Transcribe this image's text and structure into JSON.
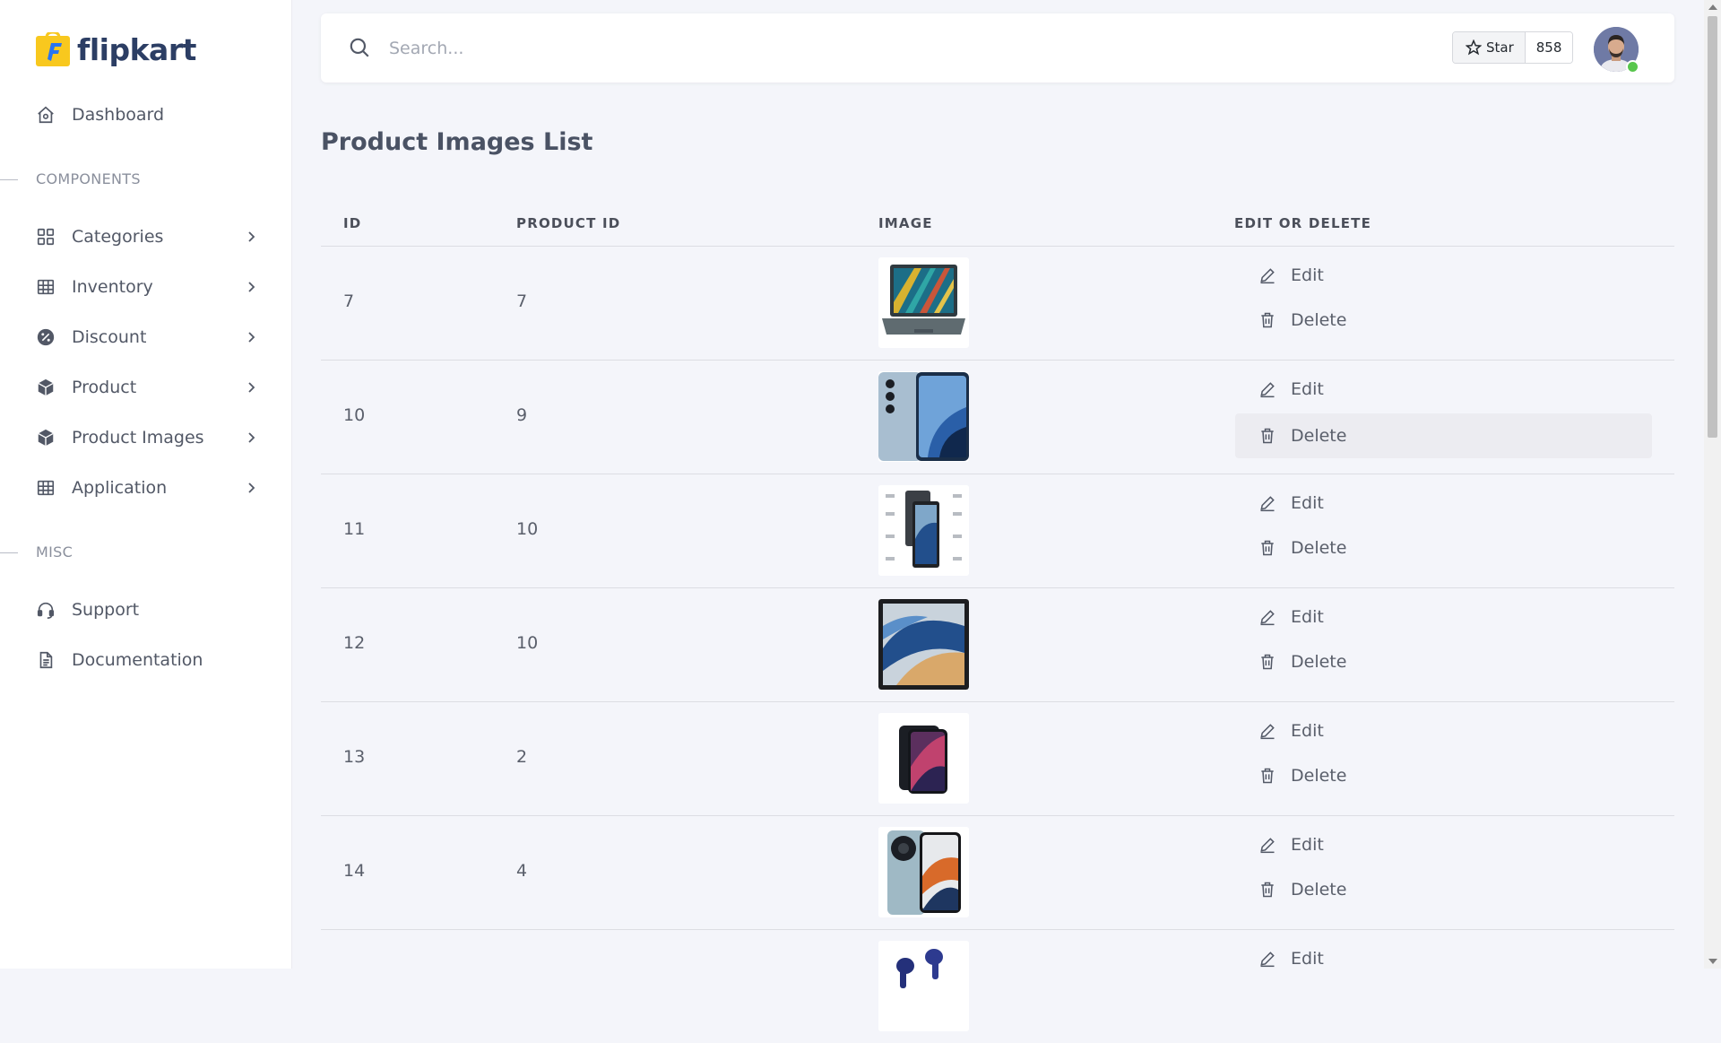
{
  "brand": {
    "name": "flipkart"
  },
  "sidebar": {
    "dashboard": "Dashboard",
    "components_label": "COMPONENTS",
    "items": [
      {
        "label": "Categories",
        "icon": "grid-icon"
      },
      {
        "label": "Inventory",
        "icon": "table-icon"
      },
      {
        "label": "Discount",
        "icon": "discount-badge-icon"
      },
      {
        "label": "Product",
        "icon": "package-icon"
      },
      {
        "label": "Product Images",
        "icon": "package-icon"
      },
      {
        "label": "Application",
        "icon": "table-icon"
      }
    ],
    "misc_label": "MISC",
    "misc_items": [
      {
        "label": "Support",
        "icon": "headset-icon"
      },
      {
        "label": "Documentation",
        "icon": "document-icon"
      }
    ]
  },
  "header": {
    "search_placeholder": "Search...",
    "star_label": "Star",
    "star_count": "858"
  },
  "main": {
    "title": "Product Images List",
    "columns": [
      "ID",
      "PRODUCT ID",
      "IMAGE",
      "EDIT OR DELETE"
    ],
    "edit_label": "Edit",
    "delete_label": "Delete",
    "rows": [
      {
        "id": "7",
        "product_id": "7",
        "image": "laptop"
      },
      {
        "id": "10",
        "product_id": "9",
        "image": "smartphone-blue"
      },
      {
        "id": "11",
        "product_id": "10",
        "image": "tablet-set"
      },
      {
        "id": "12",
        "product_id": "10",
        "image": "tablet"
      },
      {
        "id": "13",
        "product_id": "2",
        "image": "iphone"
      },
      {
        "id": "14",
        "product_id": "4",
        "image": "smartphone-camera"
      },
      {
        "id": "",
        "product_id": "",
        "image": "earbuds"
      }
    ]
  },
  "colors": {
    "accent_online": "#58c64d",
    "brand_logo": "#f8c81e",
    "brand_text": "#2c3e64"
  }
}
